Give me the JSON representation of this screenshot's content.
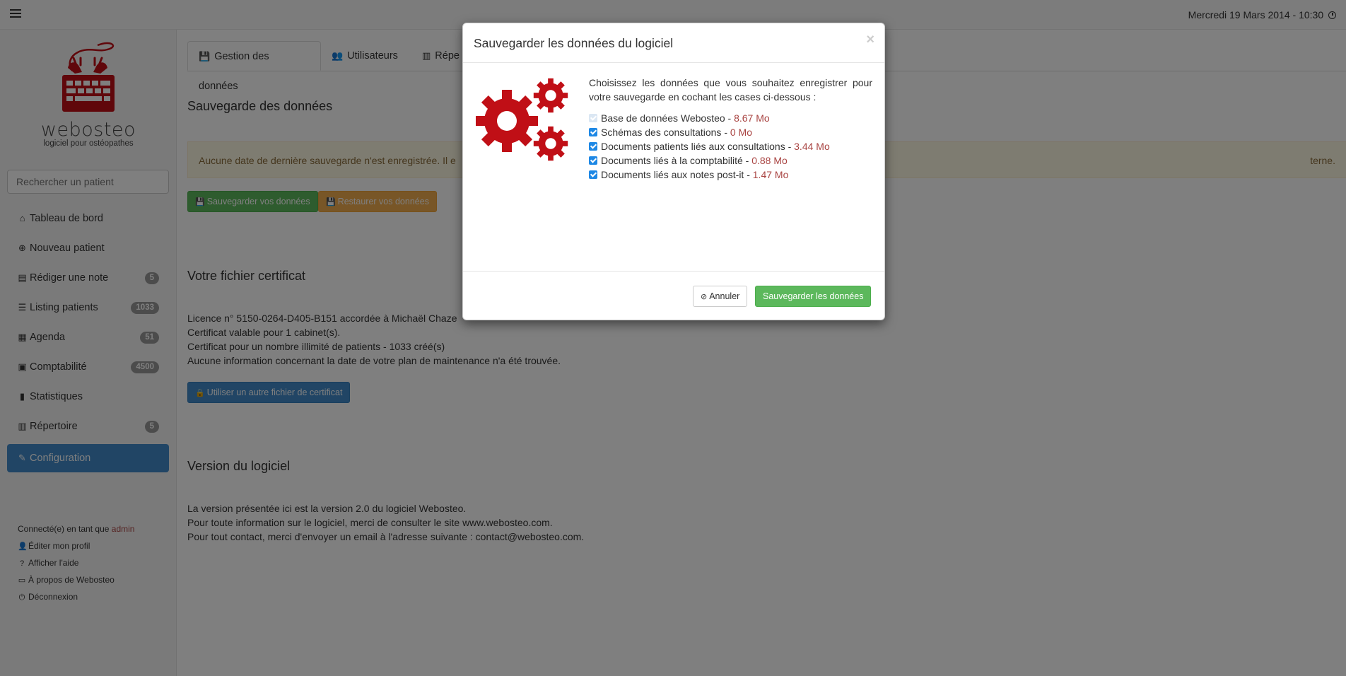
{
  "topbar": {
    "datetime": "Mercredi 19 Mars 2014 - 10:30"
  },
  "sidebar": {
    "logo_name": "webosteo",
    "logo_tagline": "logiciel pour ostéopathes",
    "search_placeholder": "Rechercher un patient",
    "items": [
      {
        "label": "Tableau de bord",
        "icon": "home-icon",
        "badge": ""
      },
      {
        "label": "Nouveau patient",
        "icon": "plus-circle-icon",
        "badge": ""
      },
      {
        "label": "Rédiger une note",
        "icon": "note-icon",
        "badge": "5"
      },
      {
        "label": "Listing patients",
        "icon": "list-icon",
        "badge": "1033"
      },
      {
        "label": "Agenda",
        "icon": "calendar-icon",
        "badge": "51"
      },
      {
        "label": "Comptabilité",
        "icon": "calculator-icon",
        "badge": "4500"
      },
      {
        "label": "Statistiques",
        "icon": "bar-chart-icon",
        "badge": ""
      },
      {
        "label": "Répertoire",
        "icon": "address-book-icon",
        "badge": "5"
      },
      {
        "label": "Configuration",
        "icon": "wrench-icon",
        "badge": ""
      }
    ],
    "connected_prefix": "Connecté(e) en tant que",
    "connected_user": "admin",
    "links": {
      "profile": "Éditer mon profil",
      "help": "Afficher l'aide",
      "about": "À propos de Webosteo",
      "logout": "Déconnexion"
    }
  },
  "main": {
    "tabs": {
      "data": "Gestion des données",
      "users": "Utilisateurs",
      "directory": "Répe"
    },
    "backup": {
      "title": "Sauvegarde des données",
      "alert_start": "Aucune date de dernière sauvegarde n'est enregistrée. Il e",
      "alert_end": "terne.",
      "save_label": "Sauvegarder vos données",
      "restore_label": "Restaurer vos données"
    },
    "certificate": {
      "title": "Votre fichier certificat",
      "lines": [
        "Licence n° 5150-0264-D405-B151 accordée à Michaël Chaze",
        "Certificat valable pour 1 cabinet(s).",
        "Certificat pour un nombre illimité de patients - 1033 créé(s)",
        "Aucune information concernant la date de votre plan de maintenance n'a été trouvée."
      ],
      "button_label": "Utiliser un autre fichier de certificat"
    },
    "version": {
      "title": "Version du logiciel",
      "lines": [
        "La version présentée ici est la version 2.0 du logiciel Webosteo.",
        "Pour toute information sur le logiciel, merci de consulter le site www.webosteo.com.",
        "Pour tout contact, merci d'envoyer un email à l'adresse suivante : contact@webosteo.com."
      ]
    }
  },
  "modal": {
    "title": "Sauvegarder les données du logiciel",
    "close": "×",
    "intro": "Choisissez les données que vous souhaitez enregistrer pour votre sauvegarde en cochant les cases ci-dessous :",
    "options": [
      {
        "label": "Base de données Webosteo - ",
        "size": "8.67 Mo",
        "checked": true,
        "disabled": true
      },
      {
        "label": "Schémas des consultations - ",
        "size": "0 Mo",
        "checked": true,
        "disabled": false
      },
      {
        "label": "Documents patients liés aux consultations - ",
        "size": "3.44 Mo",
        "checked": true,
        "disabled": false
      },
      {
        "label": "Documents liés à la comptabilité - ",
        "size": "0.88 Mo",
        "checked": true,
        "disabled": false
      },
      {
        "label": "Documents liés aux notes post-it - ",
        "size": "1.47 Mo",
        "checked": true,
        "disabled": false
      }
    ],
    "cancel_label": "Annuler",
    "save_label": "Sauvegarder les données"
  },
  "colors": {
    "brand_red": "#c00f16",
    "primary": "#428bca",
    "success": "#5cb85c",
    "warning": "#f0ad4e",
    "size_text": "#a94442"
  }
}
